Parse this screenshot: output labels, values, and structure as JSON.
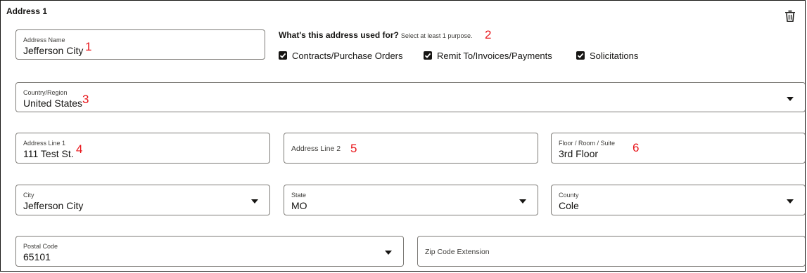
{
  "section": {
    "title": "Address 1",
    "delete_icon": "trash-icon"
  },
  "address_name": {
    "label": "Address Name",
    "value": "Jefferson City",
    "marker": "1"
  },
  "purpose": {
    "question": "What's this address used for?",
    "hint": "Select at least 1 purpose.",
    "marker": "2",
    "options": [
      {
        "label": "Contracts/Purchase Orders",
        "checked": true
      },
      {
        "label": "Remit To/Invoices/Payments",
        "checked": true
      },
      {
        "label": "Solicitations",
        "checked": true
      }
    ]
  },
  "country": {
    "label": "Country/Region",
    "value": "United States",
    "marker": "3"
  },
  "address_line_1": {
    "label": "Address Line 1",
    "value": "111 Test St.",
    "marker": "4"
  },
  "address_line_2": {
    "placeholder": "Address Line 2",
    "marker": "5"
  },
  "floor_room_suite": {
    "label": "Floor / Room / Suite",
    "value": "3rd Floor",
    "marker": "6"
  },
  "city": {
    "label": "City",
    "value": "Jefferson City"
  },
  "state": {
    "label": "State",
    "value": "MO"
  },
  "county": {
    "label": "County",
    "value": "Cole"
  },
  "postal_code": {
    "label": "Postal Code",
    "value": "65101"
  },
  "zip_extension": {
    "placeholder": "Zip Code Extension"
  },
  "colors": {
    "marker": "#e8161b",
    "border": "#7d7b77",
    "text": "#161513"
  }
}
